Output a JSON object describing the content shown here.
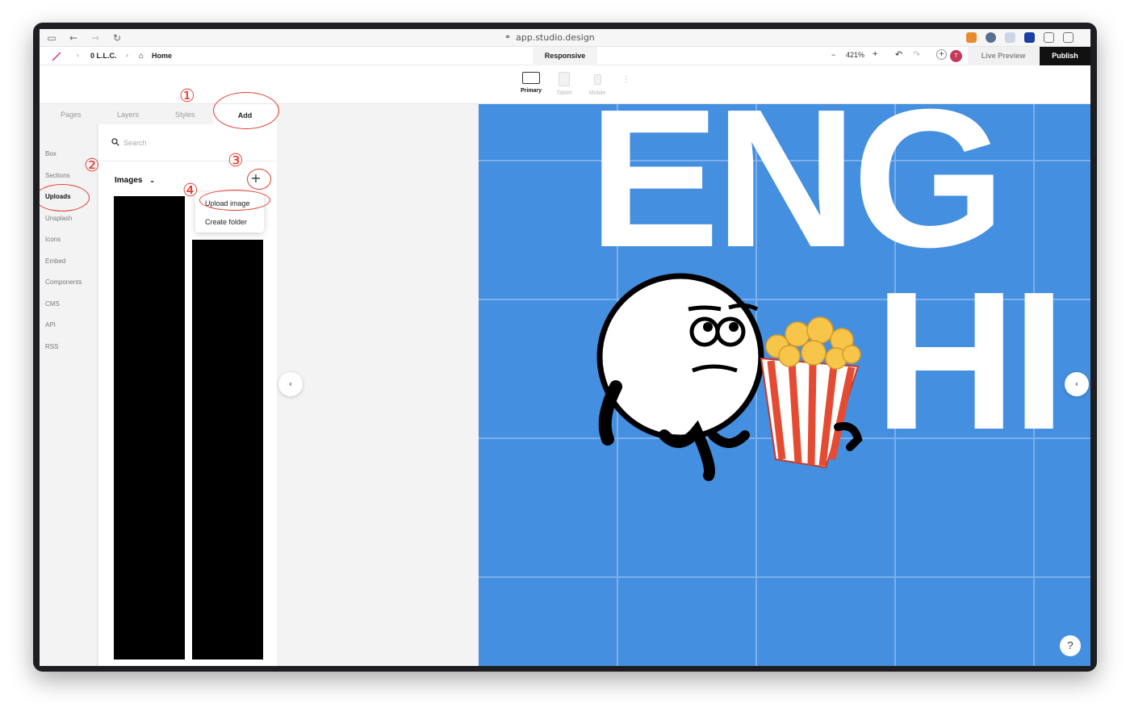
{
  "browser": {
    "url": "app.studio.design"
  },
  "toolbar": {
    "org": "0 L.L.C.",
    "page": "Home",
    "mode_tab": "Responsive",
    "zoom": "421%",
    "avatar_initial": "T",
    "live_preview": "Live Preview",
    "publish": "Publish"
  },
  "devices": [
    {
      "label": "Primary",
      "active": true
    },
    {
      "label": "Tablet",
      "active": false
    },
    {
      "label": "Mobile",
      "active": false
    }
  ],
  "panel_tabs": [
    "Pages",
    "Layers",
    "Styles",
    "Add"
  ],
  "sidebar": {
    "items": [
      "Box",
      "Sections",
      "Uploads",
      "Unsplash",
      "Icons",
      "Embed",
      "Components",
      "CMS",
      "API",
      "RSS"
    ],
    "active": "Uploads"
  },
  "uploads": {
    "search_placeholder": "Search",
    "folder_label": "Images",
    "menu": [
      "Upload image",
      "Create folder"
    ]
  },
  "canvas": {
    "heading_line1": "ENG",
    "heading_line2": "HI",
    "help": "?"
  },
  "annotations": [
    "①",
    "②",
    "③",
    "④"
  ],
  "colors": {
    "canvas_blue": "#448fe0",
    "annotation_red": "#e23b2e",
    "publish_bg": "#111111",
    "avatar_bg": "#c8385b"
  }
}
